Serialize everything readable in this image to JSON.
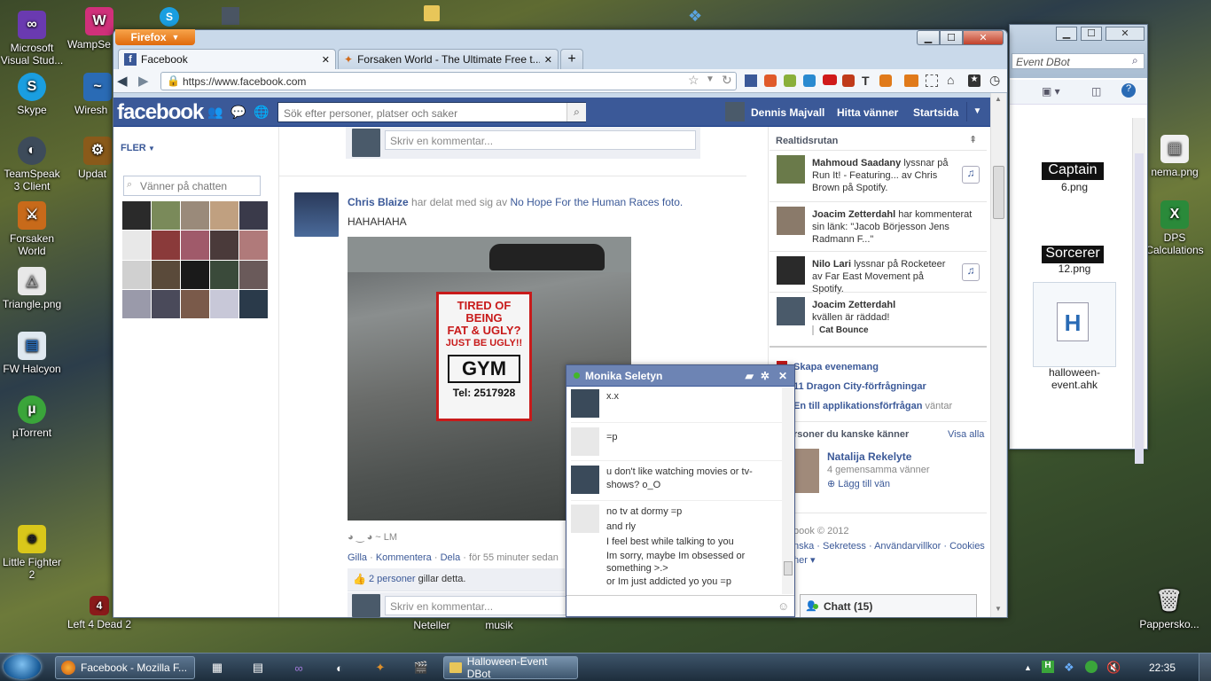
{
  "desktop": {
    "icons": [
      {
        "label": "Microsoft Visual Stud...",
        "color": "#6a3ab0"
      },
      {
        "label": "WampSe",
        "color": "#d0307a"
      },
      {
        "label": "Skype",
        "color": "#1a9ee0"
      },
      {
        "label": "Wiresh",
        "color": "#2a6bb5"
      },
      {
        "label": "TeamSpeak 3 Client",
        "color": "#3d4b5a"
      },
      {
        "label": "Updat",
        "color": "#8a5a1a"
      },
      {
        "label": "Forsaken World",
        "color": "#c86a1a"
      },
      {
        "label": "Triangle.png",
        "color": "#e8e8e8"
      },
      {
        "label": "FW Halcyon",
        "color": "#dfe8f0"
      },
      {
        "label": "µTorrent",
        "color": "#3aa53a"
      },
      {
        "label": "Little Fighter 2",
        "color": "#d9c71a"
      },
      {
        "label": "Left 4 Dead 2",
        "color": "#8a1a1a"
      },
      {
        "label": "Neteller",
        "color": "#444"
      },
      {
        "label": "musik",
        "color": "#444"
      },
      {
        "label": "Captain",
        "color": "#222"
      },
      {
        "label": "6.png",
        "color": "#222"
      },
      {
        "label": "Sorcerer",
        "color": "#222"
      },
      {
        "label": "12.png",
        "color": "#222"
      },
      {
        "label": "halloween-event.ahk",
        "color": "#fff"
      },
      {
        "label": "nema.png",
        "color": "#fff"
      },
      {
        "label": "DPS Calculations",
        "color": "#2a8a3a"
      },
      {
        "label": "Papperskо...",
        "color": "#ccc"
      }
    ]
  },
  "taskbar": {
    "items": [
      {
        "label": "Facebook - Mozilla F..."
      },
      {
        "label": "Halloween-Event DBot"
      }
    ],
    "clock": "22:35"
  },
  "explorer": {
    "title": "Halloween-Event DBot",
    "search_placeholder": "Event DBot"
  },
  "browser": {
    "app_button": "Firefox",
    "tabs": [
      {
        "label": "Facebook"
      },
      {
        "label": "Forsaken World - The Ultimate Free t..."
      }
    ],
    "url": "https://www.facebook.com"
  },
  "facebook": {
    "logo": "facebook",
    "search_placeholder": "Sök efter personer, platser och saker",
    "nav": {
      "user": "Dennis Majvall",
      "find_friends": "Hitta vänner",
      "home": "Startsida"
    },
    "left": {
      "more": "FLER",
      "chat_search_placeholder": "Vänner på chatten"
    },
    "feed": {
      "comment_placeholder": "Skriv en kommentar...",
      "post": {
        "author": "Chris Blaize",
        "shared_text": "har delat med sig av",
        "source": "No Hope For the Human Races foto.",
        "text": "HAHAHAHA",
        "sign": {
          "line1": "TIRED OF",
          "line2": "BEING",
          "line3": "FAT & UGLY?",
          "line4": "JUST BE UGLY!!",
          "line5": "GYM",
          "line6": "Tel: 2517928"
        },
        "caption": "◕ ‿ ◕ ~ LM",
        "actions": {
          "like": "Gilla",
          "comment": "Kommentera",
          "share": "Dela",
          "time": "för 55 minuter sedan"
        },
        "likes_link": "2 personer",
        "likes_suffix": "gillar detta."
      }
    },
    "ticker": {
      "title": "Realtidsrutan",
      "items": [
        {
          "name": "Mahmoud Saadany",
          "text": "lyssnar på Run It! - Featuring... av Chris Brown på Spotify."
        },
        {
          "name": "Joacim Zetterdahl",
          "text": "har kommenterat sin länk: \"Jacob Börjesson Jens Radmann F...\""
        },
        {
          "name": "Nilo Lari",
          "text": "lyssnar på Rocketeer av Far East Movement på Spotify."
        },
        {
          "name": "Joacim Zetterdahl",
          "text": "kvällen är räddad!",
          "sub": "Cat Bounce"
        }
      ]
    },
    "right": {
      "create_event": "Skapa evenemang",
      "requests1": "11 Dragon City-förfrågningar",
      "requests2": "En till applikationsförfrågan",
      "requests2_suffix": "väntar",
      "pymk_title": "rsoner du kanske känner",
      "see_all": "Visa alla",
      "suggest": {
        "name": "Natalija Rekelyte",
        "mutual": "4 gemensamma vänner",
        "add": "Lägg till vän"
      },
      "copyright": "book © 2012",
      "footer_links": "nska · Sekretess · Användarvillkor · Cookies ·",
      "footer2": "ner ▾",
      "chat_bar": "Chatt (15)"
    },
    "chat": {
      "name": "Monika Seletyn",
      "messages": [
        {
          "lines": [
            "x.x"
          ],
          "from": "friend"
        },
        {
          "lines": [
            "=p"
          ],
          "from": "other"
        },
        {
          "lines": [
            "u don't like watching movies or tv-shows? o_O"
          ],
          "from": "friend"
        },
        {
          "lines": [
            "no tv at dormy =p",
            "and rly",
            "I feel best while talking to you",
            "Im sorry, maybe Im obsessed or something >.>",
            "or Im just addicted yo you =p"
          ],
          "from": "other"
        }
      ]
    }
  }
}
